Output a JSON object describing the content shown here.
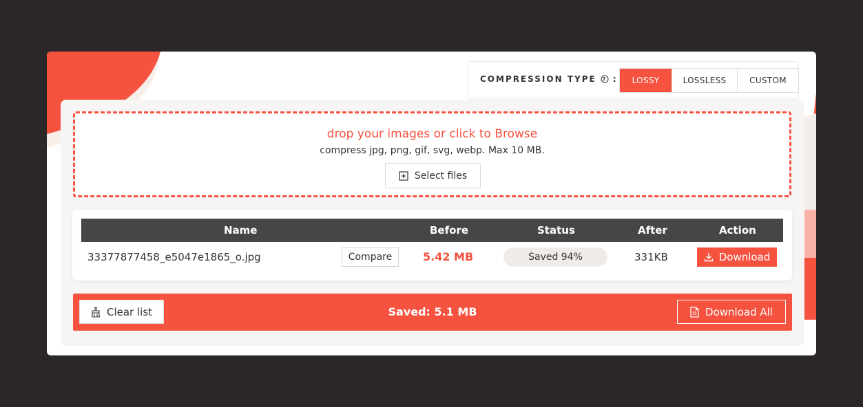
{
  "compression": {
    "label": "COMPRESSION TYPE",
    "colon": ":",
    "help_icon": "question-circle-icon",
    "options": [
      "LOSSY",
      "LOSSLESS",
      "CUSTOM"
    ],
    "selected": "LOSSY"
  },
  "dropzone": {
    "title": "drop your images or click to Browse",
    "subtitle": "compress jpg, png, gif, svg, webp. Max 10 MB.",
    "select_label": "Select files",
    "select_icon": "plus-square-icon"
  },
  "table": {
    "headers": [
      "Name",
      "Before",
      "Status",
      "After",
      "Action"
    ],
    "rows": [
      {
        "name": "33377877458_e5047e1865_o.jpg",
        "compare_label": "Compare",
        "before": "5.42 MB",
        "status": "Saved 94%",
        "after": "331KB",
        "action_label": "Download",
        "action_icon": "download-icon"
      }
    ]
  },
  "footer": {
    "clear_label": "Clear list",
    "clear_icon": "broom-icon",
    "saved_text": "Saved: 5.1 MB",
    "download_all_label": "Download All",
    "download_all_icon": "file-icon"
  },
  "colors": {
    "accent": "#f5523f",
    "background": "#2b2627",
    "header_dark": "#464646",
    "pill": "#efece8"
  }
}
